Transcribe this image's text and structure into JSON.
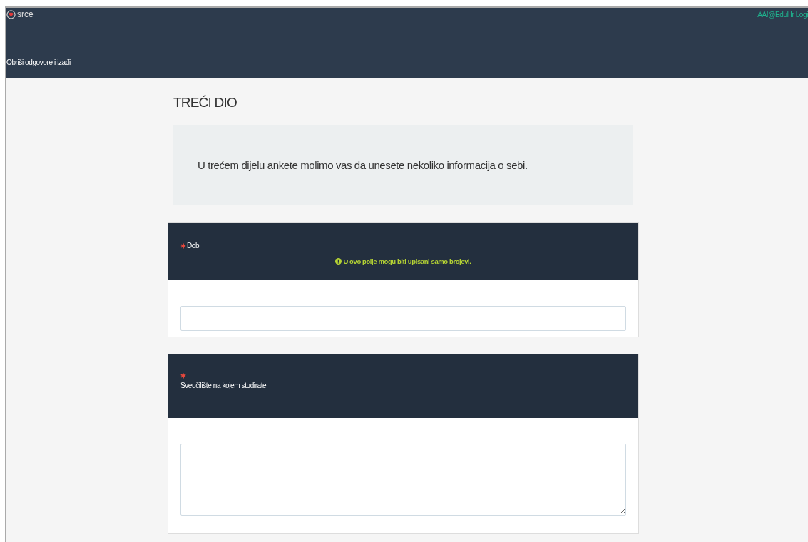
{
  "header": {
    "logo_text": "srce",
    "login_link": "AAI@EduHr Logi",
    "exit_link": "Obriši odgovore i izađi"
  },
  "section": {
    "title": "TREĆI DIO",
    "intro": "U trećem dijelu ankete molimo vas da unesete nekoliko informacija o sebi."
  },
  "questions": [
    {
      "kind": "number",
      "label": "Dob",
      "required": true,
      "hint": "U ovo polje mogu biti upisani samo brojevi."
    },
    {
      "kind": "textarea",
      "label": "Sveučilište na kojem studirate",
      "required": true
    }
  ]
}
